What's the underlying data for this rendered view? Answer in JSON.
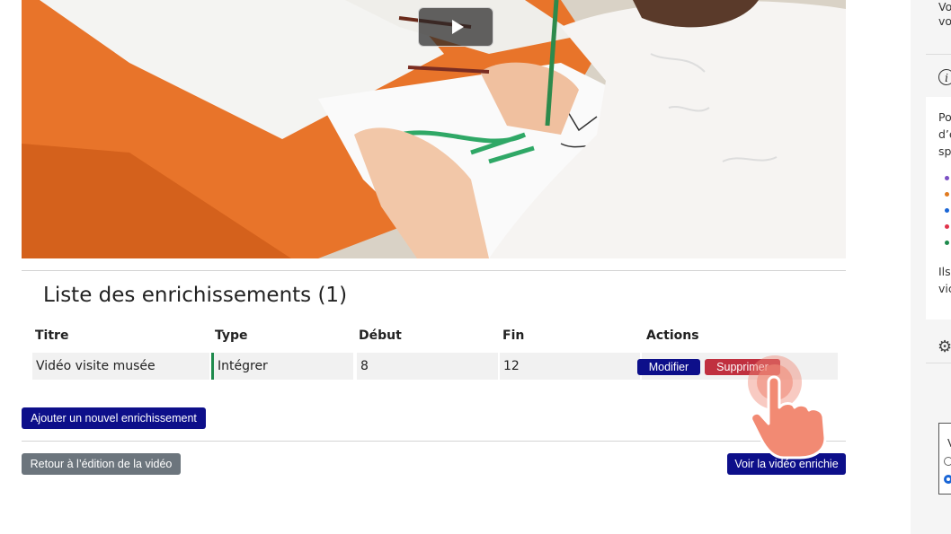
{
  "video": {
    "play_button_label": "Play"
  },
  "list": {
    "title": "Liste des enrichissements (1)",
    "columns": [
      "Titre",
      "Type",
      "Début",
      "Fin",
      "Actions"
    ],
    "rows": [
      {
        "titre": "Vidéo visite musée",
        "type": "Intégrer",
        "debut": "8",
        "fin": "12"
      }
    ],
    "modifier_label": "Modifier",
    "supprimer_label": "Supprimer"
  },
  "buttons": {
    "ajouter": "Ajouter un nouvel enrichissement",
    "retour": "Retour à l’édition de la vidéo",
    "voir": "Voir la vidéo enrichie"
  },
  "sidebar": {
    "text_top_1": "Vo",
    "text_top_2": "vo",
    "info_icon": "i",
    "para_1": "Po",
    "para_2": "d’é",
    "para_3": "sp",
    "para_4": "Ils",
    "para_5": "vic",
    "box_label": "V",
    "bullet_colors": [
      "#7b4fc4",
      "#e07a1f",
      "#1a66d6",
      "#e0334a",
      "#1e8a4c"
    ]
  },
  "colors": {
    "primary": "#0d0f8a",
    "danger": "#c0303f",
    "secondary": "#6c757d",
    "type_accent": "#1e8a4c"
  }
}
